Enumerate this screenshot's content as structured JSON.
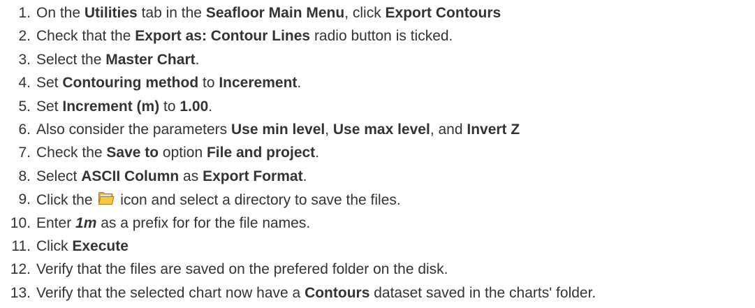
{
  "steps": [
    {
      "number": "1.",
      "parts": [
        {
          "t": "On the "
        },
        {
          "t": "Utilities",
          "b": true
        },
        {
          "t": " tab in the "
        },
        {
          "t": "Seafloor Main Menu",
          "b": true
        },
        {
          "t": ", click "
        },
        {
          "t": "Export Contours",
          "b": true
        }
      ]
    },
    {
      "number": "2.",
      "parts": [
        {
          "t": "Check that the "
        },
        {
          "t": "Export as: Contour Lines",
          "b": true
        },
        {
          "t": " radio button is ticked."
        }
      ]
    },
    {
      "number": "3.",
      "parts": [
        {
          "t": "Select the "
        },
        {
          "t": "Master Chart",
          "b": true
        },
        {
          "t": "."
        }
      ]
    },
    {
      "number": "4.",
      "parts": [
        {
          "t": "Set "
        },
        {
          "t": "Contouring method",
          "b": true
        },
        {
          "t": " to "
        },
        {
          "t": "Incerement",
          "b": true
        },
        {
          "t": "."
        }
      ]
    },
    {
      "number": "5.",
      "parts": [
        {
          "t": "Set "
        },
        {
          "t": "Increment (m)",
          "b": true
        },
        {
          "t": " to "
        },
        {
          "t": "1.00",
          "b": true
        },
        {
          "t": "."
        }
      ]
    },
    {
      "number": "6.",
      "parts": [
        {
          "t": "Also consider the parameters "
        },
        {
          "t": "Use min level",
          "b": true
        },
        {
          "t": ", "
        },
        {
          "t": "Use max level",
          "b": true
        },
        {
          "t": ", and "
        },
        {
          "t": "Invert Z",
          "b": true
        }
      ]
    },
    {
      "number": "7.",
      "parts": [
        {
          "t": "Check the "
        },
        {
          "t": "Save to",
          "b": true
        },
        {
          "t": " option "
        },
        {
          "t": "File and project",
          "b": true
        },
        {
          "t": "."
        }
      ]
    },
    {
      "number": "8.",
      "parts": [
        {
          "t": "Select "
        },
        {
          "t": "ASCII Column",
          "b": true
        },
        {
          "t": " as "
        },
        {
          "t": "Export Format",
          "b": true
        },
        {
          "t": "."
        }
      ]
    },
    {
      "number": "9.",
      "parts": [
        {
          "t": "Click the "
        },
        {
          "icon": "folder-icon"
        },
        {
          "t": " icon and select a directory to save the files."
        }
      ]
    },
    {
      "number": "10.",
      "parts": [
        {
          "t": "Enter "
        },
        {
          "t": "1m",
          "b": true,
          "i": true
        },
        {
          "t": " as a prefix for for the file names."
        }
      ]
    },
    {
      "number": "11.",
      "parts": [
        {
          "t": "Click "
        },
        {
          "t": "Execute",
          "b": true
        }
      ]
    },
    {
      "number": "12.",
      "parts": [
        {
          "t": "Verify that the files are saved on the prefered folder on the disk."
        }
      ]
    },
    {
      "number": "13.",
      "parts": [
        {
          "t": "Verify that the selected chart now have a "
        },
        {
          "t": "Contours",
          "b": true
        },
        {
          "t": " dataset saved in the charts' folder."
        }
      ]
    }
  ],
  "icon_colors": {
    "folder_fill": "#F5C842",
    "folder_back": "#E8A92A",
    "folder_stroke": "#B07A10",
    "folder_paper": "#D8E4F0"
  }
}
